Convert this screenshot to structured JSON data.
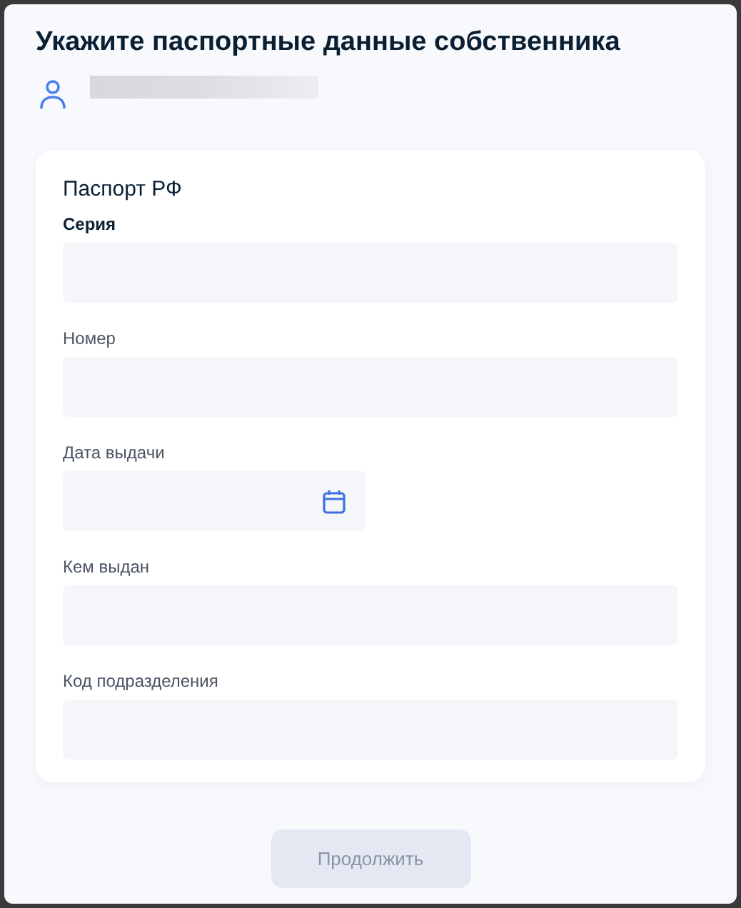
{
  "title": "Укажите паспортные данные собственника",
  "card": {
    "title": "Паспорт РФ",
    "fields": [
      {
        "label": "Серия",
        "kind": "text",
        "highlighted": true
      },
      {
        "label": "Номер",
        "kind": "text",
        "highlighted": false
      },
      {
        "label": "Дата выдачи",
        "kind": "date",
        "highlighted": false
      },
      {
        "label": "Кем выдан",
        "kind": "text",
        "highlighted": false
      },
      {
        "label": "Код подразделения",
        "kind": "text",
        "highlighted": false
      }
    ]
  },
  "button": {
    "label": "Продолжить",
    "disabled": true
  }
}
